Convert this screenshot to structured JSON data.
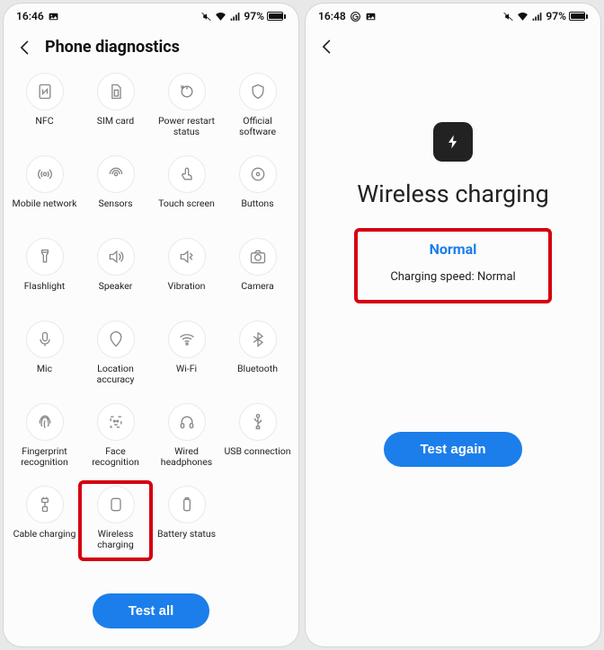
{
  "left": {
    "status": {
      "time": "16:46",
      "battery": "97%"
    },
    "title": "Phone diagnostics",
    "items": [
      {
        "id": "nfc",
        "label": "NFC",
        "icon": "nfc"
      },
      {
        "id": "sim",
        "label": "SIM card",
        "icon": "sim"
      },
      {
        "id": "restart",
        "label": "Power restart status",
        "icon": "restart"
      },
      {
        "id": "software",
        "label": "Official software",
        "icon": "shield"
      },
      {
        "id": "mobile-network",
        "label": "Mobile network",
        "icon": "antenna"
      },
      {
        "id": "sensors",
        "label": "Sensors",
        "icon": "sensors"
      },
      {
        "id": "touch",
        "label": "Touch screen",
        "icon": "touch"
      },
      {
        "id": "buttons",
        "label": "Buttons",
        "icon": "button-dot"
      },
      {
        "id": "flashlight",
        "label": "Flashlight",
        "icon": "flashlight"
      },
      {
        "id": "speaker",
        "label": "Speaker",
        "icon": "speaker"
      },
      {
        "id": "vibration",
        "label": "Vibration",
        "icon": "vibration"
      },
      {
        "id": "camera",
        "label": "Camera",
        "icon": "camera"
      },
      {
        "id": "mic",
        "label": "Mic",
        "icon": "mic"
      },
      {
        "id": "location",
        "label": "Location accuracy",
        "icon": "location"
      },
      {
        "id": "wifi",
        "label": "Wi-Fi",
        "icon": "wifi"
      },
      {
        "id": "bluetooth",
        "label": "Bluetooth",
        "icon": "bluetooth"
      },
      {
        "id": "fingerprint",
        "label": "Fingerprint recognition",
        "icon": "fingerprint"
      },
      {
        "id": "face",
        "label": "Face recognition",
        "icon": "face"
      },
      {
        "id": "headphones",
        "label": "Wired headphones",
        "icon": "headphones"
      },
      {
        "id": "usb",
        "label": "USB connection",
        "icon": "usb"
      },
      {
        "id": "cable-charging",
        "label": "Cable charging",
        "icon": "cable-charge"
      },
      {
        "id": "wireless-charging",
        "label": "Wireless charging",
        "icon": "bolt-box",
        "highlighted": true
      },
      {
        "id": "battery-status",
        "label": "Battery status",
        "icon": "battery"
      }
    ],
    "cta": "Test all"
  },
  "right": {
    "status": {
      "time": "16:48",
      "battery": "97%"
    },
    "result": {
      "icon": "bolt",
      "title": "Wireless charging",
      "status": "Normal",
      "detail": "Charging speed: Normal"
    },
    "cta": "Test again"
  }
}
